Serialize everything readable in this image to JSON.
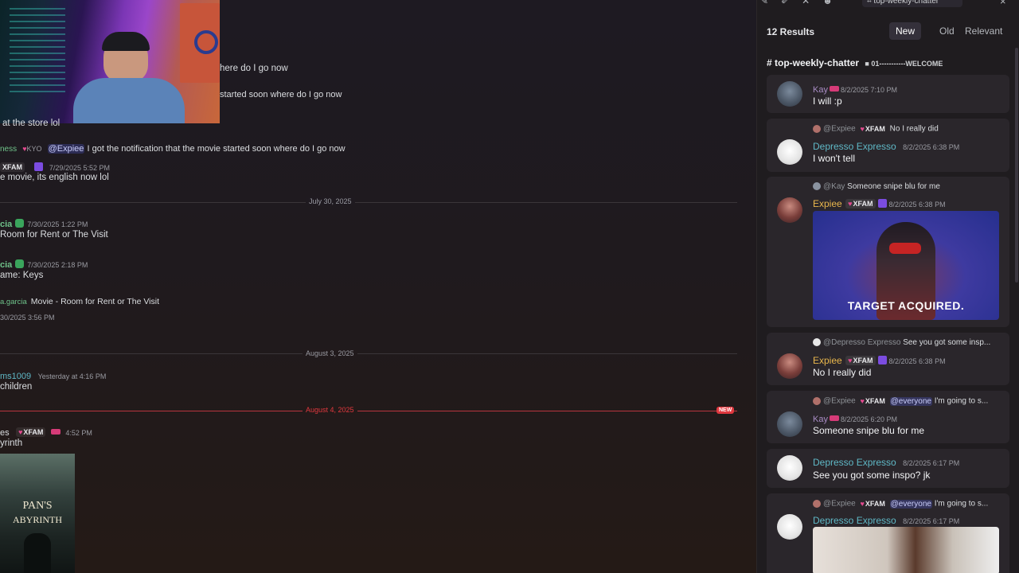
{
  "chat": {
    "msg1_tail": "here do I go now",
    "msg2_tail": "started soon where do I go now",
    "msg3_text": "at the store lol",
    "msg4_name_partial": "ness",
    "msg4_tag": "KYO",
    "msg4_mention": "@Expiee",
    "msg4_text": "I got the notification that the movie started soon where do I go now",
    "msg5_tag": "XFAM",
    "msg5_time": "7/29/2025 5:52 PM",
    "msg5_text": "e movie, its english now lol",
    "divider1": "July 30, 2025",
    "msg6_name": "cia",
    "msg6_time": "7/30/2025 1:22 PM",
    "msg6_text": "Room for Rent or The Visit",
    "msg7_name": "cia",
    "msg7_time": "7/30/2025 2:18 PM",
    "msg7_text": "ame: Keys",
    "msg8_reply_name": "a.garcia",
    "msg8_reply_text": "Movie - Room for Rent or The Visit",
    "msg8_time": "30/2025 3:56 PM",
    "divider2": "August 3, 2025",
    "msg9_name": "ms1009",
    "msg9_time": "Yesterday at 4:16 PM",
    "msg9_text": "children",
    "divider3": "August 4, 2025",
    "new_badge": "NEW",
    "msg10_name": "es",
    "msg10_tag": "XFAM",
    "msg10_time": "4:52 PM",
    "msg10_text": "yrinth",
    "poster_line1": "PAN'S",
    "poster_line2": "ABYRINTH"
  },
  "search_panel": {
    "channel_pill": "top-weekly-chatter",
    "close": "×",
    "results_count": "12 Results",
    "sort": [
      "New",
      "Old",
      "Relevant"
    ],
    "channel_header": "# top-weekly-chatter",
    "category": "01-----------WELCOME",
    "results": [
      {
        "name": "Kay",
        "time": "8/2/2025 7:10 PM",
        "text": "I will :p"
      },
      {
        "reply_name": "@Expiee",
        "reply_tag": "XFAM",
        "reply_text": "No I really did",
        "name": "Depresso Expresso",
        "time": "8/2/2025 6:38 PM",
        "text": "I won't tell"
      },
      {
        "reply_name": "@Kay",
        "reply_text": "Someone snipe blu for me",
        "name": "Expiee",
        "tag": "XFAM",
        "time": "8/2/2025 6:38 PM",
        "gif_caption": "TARGET ACQUIRED."
      },
      {
        "reply_name": "@Depresso Expresso",
        "reply_text": "See you got some insp...",
        "name": "Expiee",
        "tag": "XFAM",
        "time": "8/2/2025 6:38 PM",
        "text": "No I really did"
      },
      {
        "reply_name": "@Expiee",
        "reply_tag": "XFAM",
        "reply_mention": "@everyone",
        "reply_text": "I'm going to s...",
        "name": "Kay",
        "time": "8/2/2025 6:20 PM",
        "text": "Someone snipe blu for me"
      },
      {
        "name": "Depresso Expresso",
        "time": "8/2/2025 6:17 PM",
        "text": "See you got some inspo? jk"
      },
      {
        "reply_name": "@Expiee",
        "reply_tag": "XFAM",
        "reply_mention": "@everyone",
        "reply_text": "I'm going to s...",
        "name": "Depresso Expresso",
        "time": "8/2/2025 6:17 PM"
      }
    ]
  },
  "colors": {
    "kay": "#a98dc5",
    "depresso": "#5fb8c6",
    "expiee": "#e8b64c",
    "accent_red": "#e0383f"
  }
}
